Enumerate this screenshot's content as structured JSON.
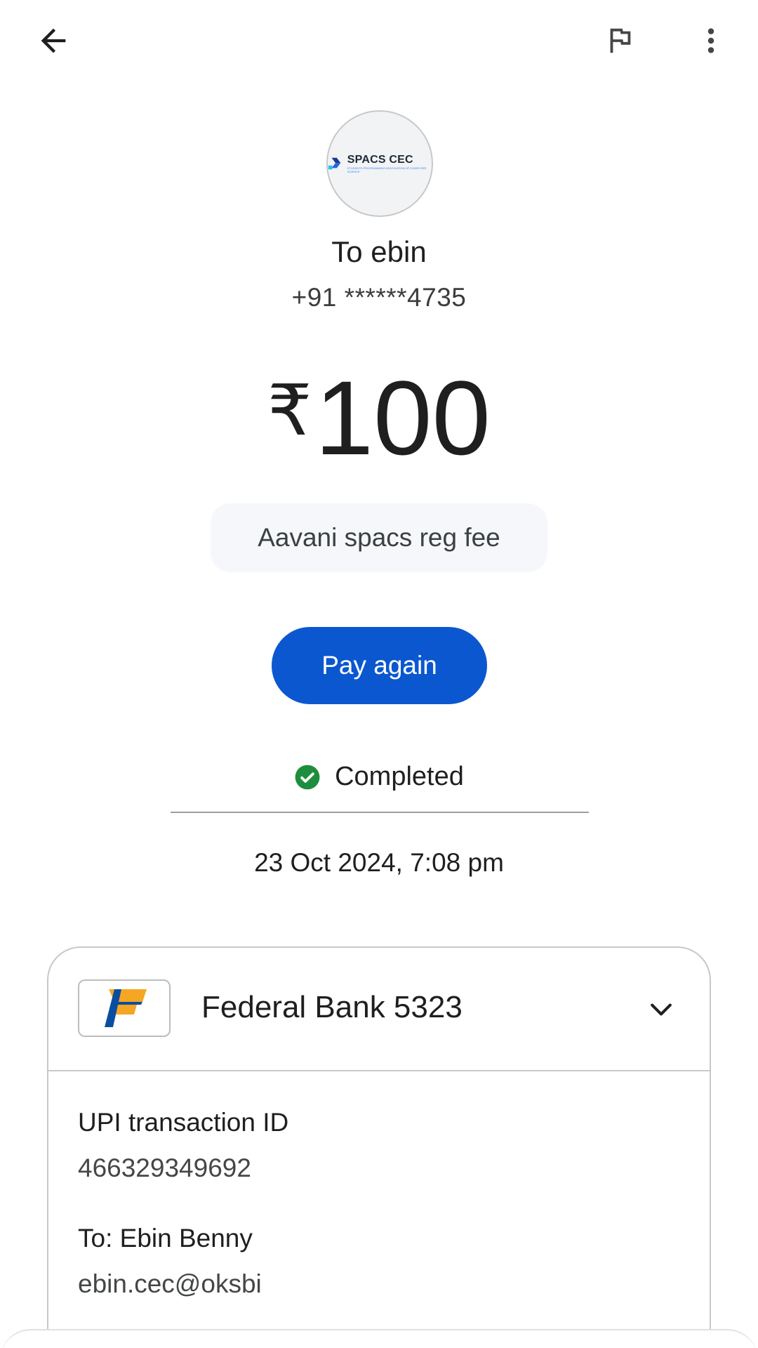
{
  "topbar": {
    "back_icon": "arrow-back-icon",
    "flag_icon": "flag-icon",
    "more_icon": "more-vert-icon"
  },
  "recipient": {
    "avatar_logo_text": "SPACS CEC",
    "avatar_logo_subtext": "STUDENTS PROGRAMMING ASSOCIATION OF COMPUTER SCIENCE",
    "to_label": "To ebin",
    "phone": "+91 ******4735"
  },
  "payment": {
    "currency": "₹",
    "amount": "100",
    "note": "Aavani spacs reg fee",
    "pay_again_label": "Pay again",
    "status": "Completed",
    "status_color": "#1e8e3e",
    "timestamp": "23 Oct 2024, 7:08 pm"
  },
  "bank": {
    "name": "Federal Bank 5323",
    "logo_icon": "federal-bank-logo",
    "chevron_icon": "chevron-down-icon"
  },
  "details": {
    "txid_label": "UPI transaction ID",
    "txid_value": "466329349692",
    "to_label": "To: Ebin  Benny",
    "to_value": "ebin.cec@oksbi"
  },
  "colors": {
    "primary_button": "#0b57d0",
    "note_background": "#f5f7fb"
  }
}
